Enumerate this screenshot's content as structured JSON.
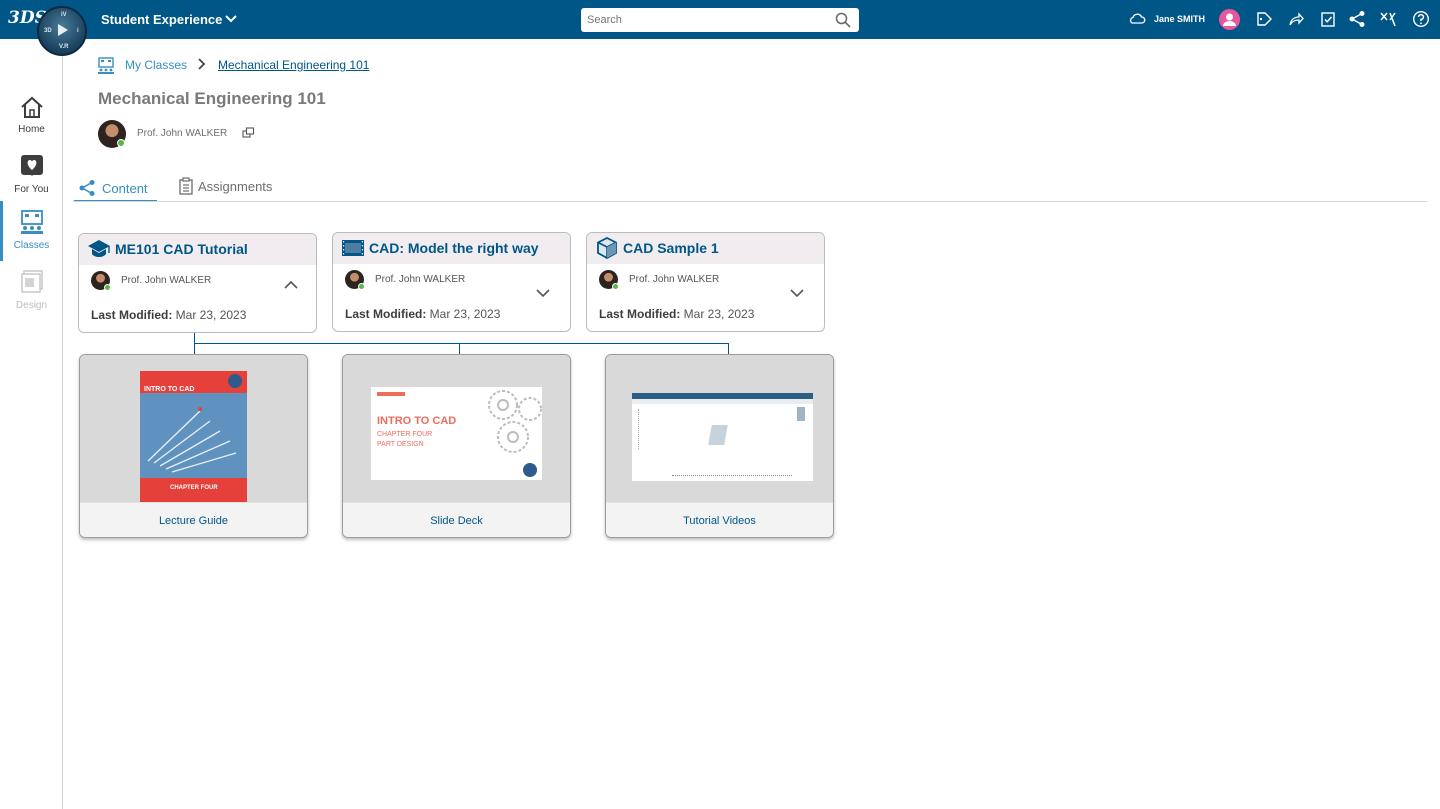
{
  "topbar": {
    "brand": "3DS",
    "compass_labels": [
      "3D",
      "V.R",
      "i",
      "iV"
    ],
    "app_title": "Student Experience",
    "search_placeholder": "Search",
    "user_name": "Jane SMITH",
    "icons": [
      "cloud-icon",
      "user-avatar",
      "tag-icon",
      "share-arrow-icon",
      "clipboard-check-icon",
      "share-network-icon",
      "tools-icon",
      "help-icon"
    ]
  },
  "sidebar": {
    "items": [
      {
        "label": "Home",
        "icon": "home-icon",
        "state": "normal"
      },
      {
        "label": "For You",
        "icon": "heart-icon",
        "state": "normal"
      },
      {
        "label": "Classes",
        "icon": "classes-icon",
        "state": "active"
      },
      {
        "label": "Design",
        "icon": "design-icon",
        "state": "disabled"
      }
    ]
  },
  "breadcrumb": {
    "root": "My Classes",
    "current": "Mechanical Engineering 101"
  },
  "page": {
    "title": "Mechanical Engineering 101",
    "professor": "Prof. John WALKER"
  },
  "tabs": [
    {
      "label": "Content",
      "active": true
    },
    {
      "label": "Assignments",
      "active": false
    }
  ],
  "cards": [
    {
      "title": "ME101 CAD Tutorial",
      "icon": "graduation-cap-icon",
      "professor": "Prof. John WALKER",
      "modified_label": "Last Modified:",
      "modified_date": "Mar 23, 2023",
      "expanded": true
    },
    {
      "title": "CAD: Model the right way",
      "icon": "film-icon",
      "professor": "Prof. John WALKER",
      "modified_label": "Last Modified:",
      "modified_date": "Mar 23, 2023",
      "expanded": false
    },
    {
      "title": "CAD Sample 1",
      "icon": "cube-icon",
      "professor": "Prof. John WALKER",
      "modified_label": "Last Modified:",
      "modified_date": "Mar 23, 2023",
      "expanded": false
    }
  ],
  "resources": [
    {
      "label": "Lecture Guide",
      "thumb_title": "INTRO TO CAD",
      "thumb_chapter": "CHAPTER FOUR"
    },
    {
      "label": "Slide Deck",
      "thumb_title": "INTRO TO CAD",
      "thumb_chapter": "CHAPTER FOUR",
      "thumb_sub": "PART DESIGN"
    },
    {
      "label": "Tutorial Videos"
    }
  ],
  "colors": {
    "brand": "#005686",
    "accent": "#368ec4",
    "online": "#57b847"
  }
}
